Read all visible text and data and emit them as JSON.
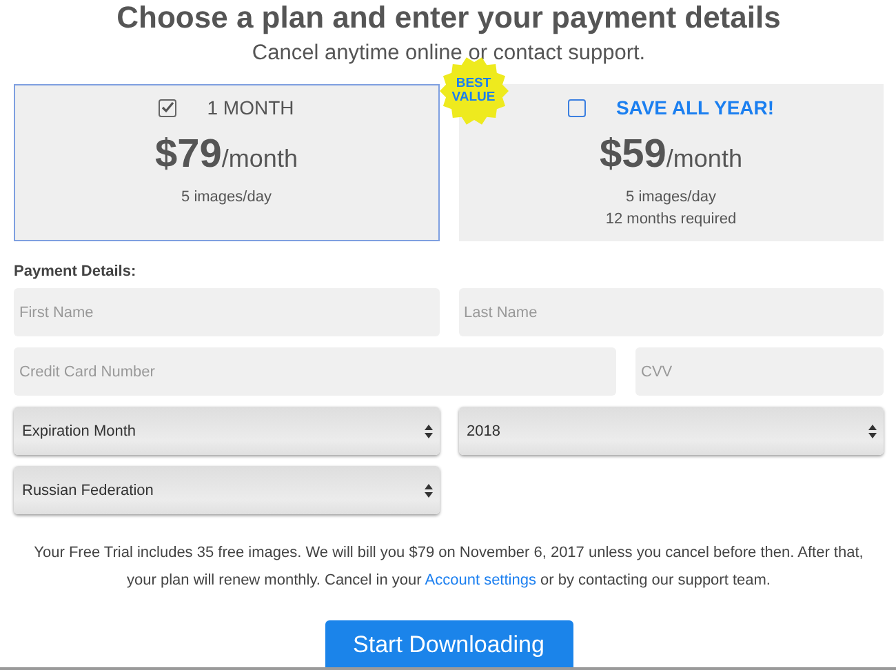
{
  "heading": "Choose a plan and enter your payment details",
  "subheading": "Cancel anytime online or contact support.",
  "plans": [
    {
      "kind": "standard",
      "title": "1 MONTH",
      "price": "$79",
      "period": "/month",
      "details": [
        "5 images/day"
      ],
      "selected": true
    },
    {
      "kind": "featured",
      "title": "SAVE ALL YEAR!",
      "price": "$59",
      "period": "/month",
      "details": [
        "5 images/day",
        "12 months required"
      ],
      "selected": false,
      "badge": "BEST VALUE"
    }
  ],
  "payment_label": "Payment Details:",
  "field_rows": [
    [
      {
        "kind": "text",
        "placeholder": "First Name"
      },
      {
        "kind": "text",
        "placeholder": "Last Name"
      }
    ],
    [
      {
        "kind": "text",
        "placeholder": "Credit Card Number"
      },
      {
        "kind": "text",
        "placeholder": "CVV"
      }
    ],
    [
      {
        "kind": "select",
        "value": "Expiration Month"
      },
      {
        "kind": "select",
        "value": "2018"
      }
    ],
    [
      {
        "kind": "select",
        "value": "Russian Federation"
      }
    ]
  ],
  "notice": {
    "before": "Your Free Trial includes 35 free images. We will bill you $79 on November 6, 2017 unless you cancel before then. After that, your plan will renew monthly. Cancel in your ",
    "link": "Account settings",
    "after": " or by contacting our support team."
  },
  "submit": "Start Downloading"
}
